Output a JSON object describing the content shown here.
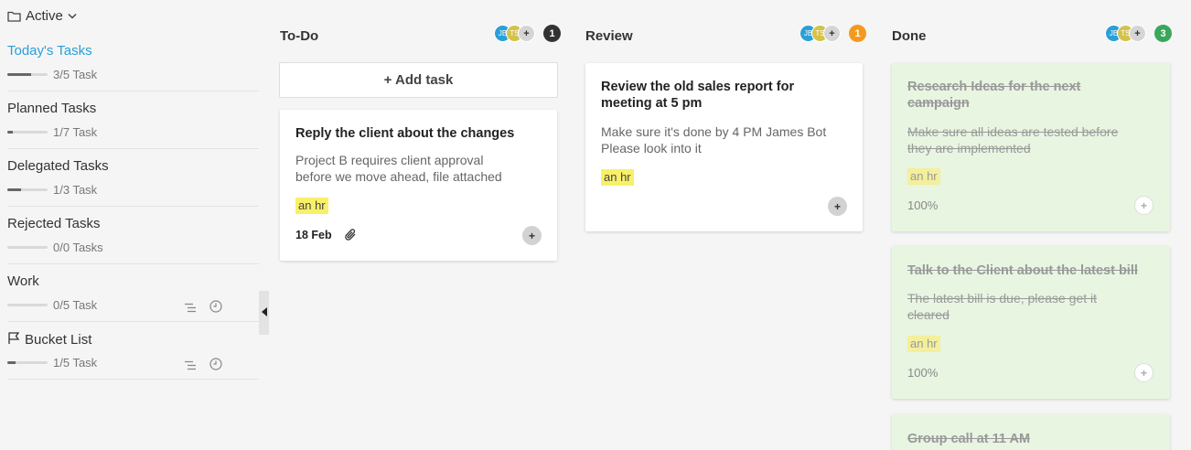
{
  "sidebar": {
    "filter_label": "Active",
    "items": [
      {
        "title": "Today's Tasks",
        "count": "3/5 Task",
        "progress": 0.6,
        "selected": true
      },
      {
        "title": "Planned Tasks",
        "count": "1/7 Task",
        "progress": 0.14
      },
      {
        "title": "Delegated Tasks",
        "count": "1/3 Task",
        "progress": 0.33
      },
      {
        "title": "Rejected Tasks",
        "count": "0/0 Tasks",
        "progress": 0
      },
      {
        "title": "Work",
        "count": "0/5 Task",
        "progress": 0
      },
      {
        "title": "Bucket List",
        "count": "1/5 Task",
        "progress": 0.2
      }
    ]
  },
  "columns": {
    "todo": {
      "title": "To-Do",
      "badge": "1",
      "avatars": [
        "JB",
        "TS",
        "+"
      ],
      "add_task": "+ Add task",
      "cards": [
        {
          "title": "Reply the client about the changes",
          "desc_line1": "Project B requires client approval",
          "desc_line2": "before we move ahead, file attached",
          "tag": "an hr",
          "date": "18 Feb"
        }
      ]
    },
    "review": {
      "title": "Review",
      "badge": "1",
      "avatars": [
        "JB",
        "TS",
        "+"
      ],
      "cards": [
        {
          "title_line1": "Review the old sales report for",
          "title_line2": "meeting at 5 pm",
          "desc_line1": "Make sure it's done by 4 PM James Bot",
          "desc_line2": "Please look into it",
          "tag": "an hr"
        }
      ]
    },
    "done": {
      "title": "Done",
      "badge": "3",
      "avatars": [
        "JB",
        "TS",
        "+"
      ],
      "cards": [
        {
          "title_line1": "Research Ideas for the next",
          "title_line2": "campaign",
          "desc_line1": "Make sure all ideas are tested before",
          "desc_line2": "they are implemented",
          "tag": "an hr",
          "percent": "100%"
        },
        {
          "title_line1": "Talk to the Client about the latest bill",
          "desc_line1": "The latest bill is due, please get it",
          "desc_line2": "cleared",
          "tag": "an hr",
          "percent": "100%"
        },
        {
          "title_line1": "Group call at 11 AM"
        }
      ]
    }
  },
  "colors": {
    "accent": "#2a9fd8",
    "todo_badge": "#333333",
    "review_badge": "#f39a1e",
    "done_badge": "#3aa65a",
    "tag": "#f9f06a",
    "done_card": "#e8f5e1"
  }
}
